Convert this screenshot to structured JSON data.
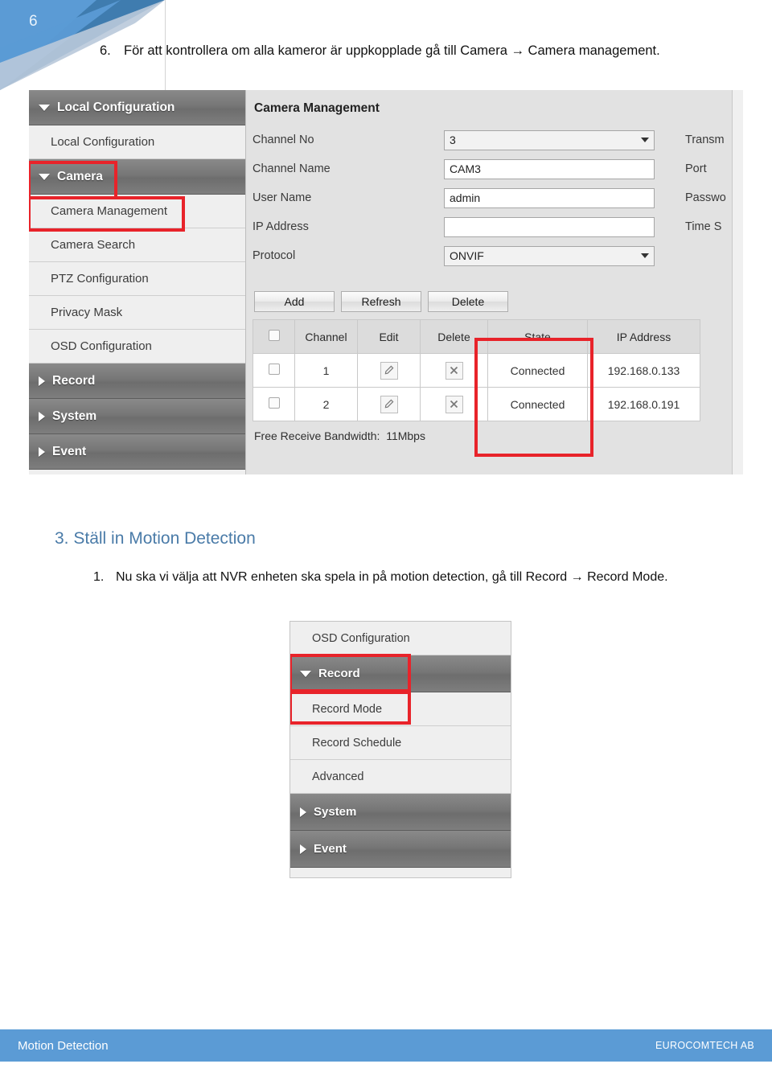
{
  "page": {
    "number": "6",
    "footer_left": "Motion Detection",
    "footer_right": "EUROCOMTECH AB",
    "accent_blue": "#5B9BD5",
    "heading_blue": "#4A7BA8",
    "annotation_red": "#E8232A"
  },
  "intro_step": {
    "number": "6.",
    "text": "För att kontrollera om alla kameror är uppkopplade gå till Camera → Camera management."
  },
  "screenshot_camera_management": {
    "sidebar": [
      {
        "label": "Local Configuration",
        "type": "group",
        "icon": "triangle-down-icon",
        "expanded": true
      },
      {
        "label": "Local Configuration",
        "type": "item",
        "highlighted": false
      },
      {
        "label": "Camera",
        "type": "group",
        "icon": "triangle-down-icon",
        "expanded": true,
        "highlighted": true
      },
      {
        "label": "Camera Management",
        "type": "item",
        "highlighted": true
      },
      {
        "label": "Camera Search",
        "type": "item",
        "highlighted": false
      },
      {
        "label": "PTZ Configuration",
        "type": "item",
        "highlighted": false
      },
      {
        "label": "Privacy Mask",
        "type": "item",
        "highlighted": false
      },
      {
        "label": "OSD Configuration",
        "type": "item",
        "highlighted": false
      },
      {
        "label": "Record",
        "type": "group",
        "icon": "triangle-right-icon",
        "expanded": false
      },
      {
        "label": "System",
        "type": "group",
        "icon": "triangle-right-icon",
        "expanded": false
      },
      {
        "label": "Event",
        "type": "group",
        "icon": "triangle-right-icon",
        "expanded": false
      }
    ],
    "pane_title": "Camera Management",
    "form": [
      {
        "label": "Channel No",
        "value": "3",
        "control": "select",
        "right_label": "Transm"
      },
      {
        "label": "Channel Name",
        "value": "CAM3",
        "control": "input",
        "right_label": "Port"
      },
      {
        "label": "User Name",
        "value": "admin",
        "control": "input",
        "right_label": "Passwo"
      },
      {
        "label": "IP Address",
        "value": "",
        "control": "input",
        "right_label": "Time S"
      },
      {
        "label": "Protocol",
        "value": "ONVIF",
        "control": "select",
        "right_label": ""
      }
    ],
    "buttons": [
      "Add",
      "Refresh",
      "Delete"
    ],
    "table": {
      "columns": [
        "",
        "Channel",
        "Edit",
        "Delete",
        "State",
        "IP Address"
      ],
      "rows": [
        {
          "channel": "1",
          "edit": "pencil-icon",
          "delete": "x-icon",
          "state": "Connected",
          "ip": "192.168.0.133"
        },
        {
          "channel": "2",
          "edit": "pencil-icon",
          "delete": "x-icon",
          "state": "Connected",
          "ip": "192.168.0.191"
        }
      ]
    },
    "bandwidth_label": "Free Receive Bandwidth:",
    "bandwidth_value": "11Mbps"
  },
  "section": {
    "heading": "3. Ställ in Motion Detection",
    "step_number": "1.",
    "step_text": "Nu ska vi välja att NVR enheten ska spela in på motion detection, gå till Record → Record Mode."
  },
  "screenshot_record_menu": {
    "items": [
      {
        "label": "OSD Configuration",
        "type": "item",
        "highlighted": false
      },
      {
        "label": "Record",
        "type": "group",
        "icon": "triangle-down-icon",
        "expanded": true,
        "highlighted": true
      },
      {
        "label": "Record Mode",
        "type": "item",
        "highlighted": true
      },
      {
        "label": "Record Schedule",
        "type": "item",
        "highlighted": false
      },
      {
        "label": "Advanced",
        "type": "item",
        "highlighted": false
      },
      {
        "label": "System",
        "type": "group",
        "icon": "triangle-right-icon",
        "expanded": false
      },
      {
        "label": "Event",
        "type": "group",
        "icon": "triangle-right-icon",
        "expanded": false
      }
    ]
  }
}
